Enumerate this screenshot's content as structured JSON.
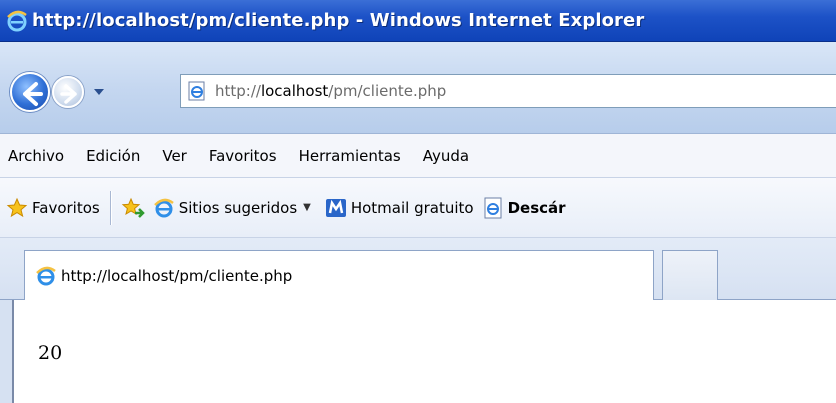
{
  "window": {
    "title": "http://localhost/pm/cliente.php - Windows Internet Explorer"
  },
  "address_bar": {
    "url_prefix": "http://",
    "url_host": "localhost",
    "url_path": "/pm/cliente.php"
  },
  "menu": {
    "items": [
      "Archivo",
      "Edición",
      "Ver",
      "Favoritos",
      "Herramientas",
      "Ayuda"
    ]
  },
  "favorites_bar": {
    "favorites_label": "Favoritos",
    "suggested_label": "Sitios sugeridos",
    "hotmail_label": "Hotmail gratuito",
    "download_label": "Descár"
  },
  "tabs": {
    "active_label": "http://localhost/pm/cliente.php"
  },
  "page": {
    "content_text": "20"
  },
  "colors": {
    "titlebar": "#1d52c7",
    "accent": "#3b6fd6"
  }
}
